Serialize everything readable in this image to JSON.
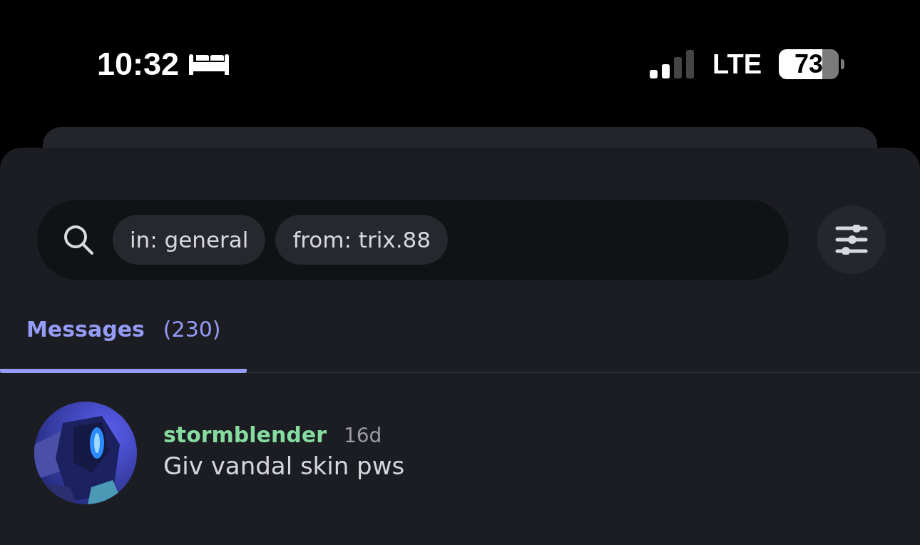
{
  "status_bar": {
    "time": "10:32",
    "network": "LTE",
    "battery": "73"
  },
  "search": {
    "filters": [
      "in: general",
      "from: trix.88"
    ]
  },
  "tabs": [
    {
      "label": "Messages",
      "count": "(230)",
      "selected": true
    }
  ],
  "messages": [
    {
      "author": "stormblender",
      "time": "16d",
      "text": "Giv vandal skin pws"
    }
  ]
}
